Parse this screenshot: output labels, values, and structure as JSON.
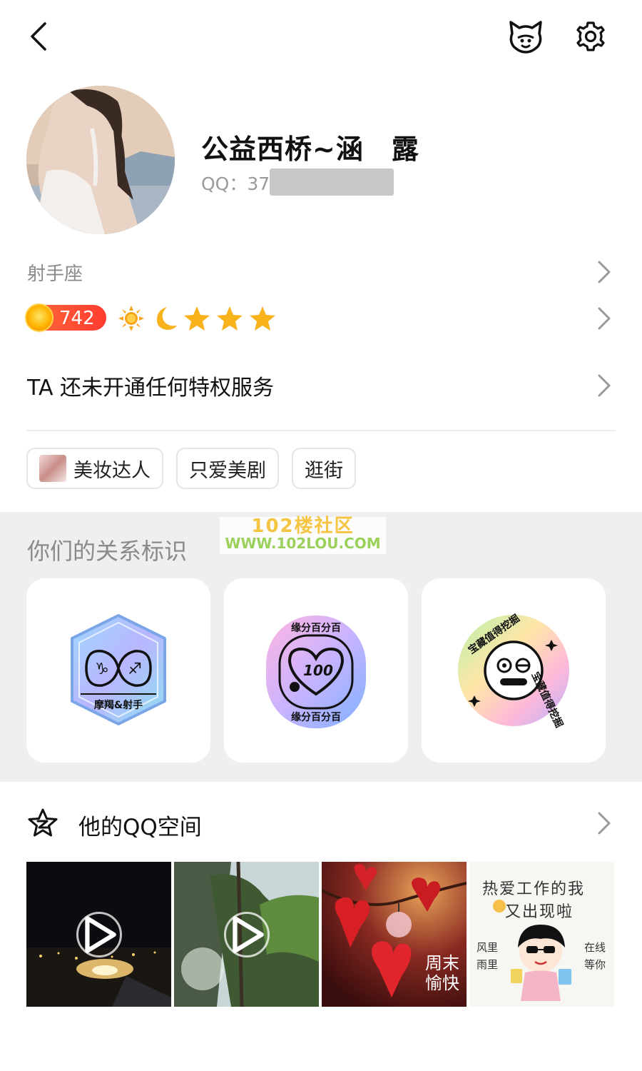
{
  "header": {
    "back_icon": "chevron-left-icon",
    "pet_icon": "pet-face-icon",
    "settings_icon": "gear-icon"
  },
  "profile": {
    "nickname": "公益西桥~涵　露",
    "qq_prefix": "QQ：37"
  },
  "zodiac": {
    "label": "射手座"
  },
  "level": {
    "number": "742",
    "icons": [
      "sun-icon",
      "moon-icon",
      "star-icon",
      "star-icon",
      "star-icon"
    ]
  },
  "privilege": {
    "label": "TA 还未开通任何特权服务"
  },
  "tags": [
    {
      "label": "美妆达人",
      "has_thumb": true
    },
    {
      "label": "只爱美剧",
      "has_thumb": false
    },
    {
      "label": "逛街",
      "has_thumb": false
    }
  ],
  "relation": {
    "title": "你们的关系标识",
    "badges": [
      {
        "name": "zodiac-badge",
        "caption": "摩羯&射手",
        "symbols": [
          "♑",
          "♐"
        ]
      },
      {
        "name": "fate-badge",
        "ring_text": "缘分百分百",
        "inner": "100"
      },
      {
        "name": "treasure-badge",
        "ring_text": "宝藏值得挖掘"
      }
    ]
  },
  "watermark": {
    "line1": "102楼社区",
    "line2": "WWW.102LOU.COM"
  },
  "qzone": {
    "title": "他的QQ空间",
    "photos": [
      {
        "kind": "video"
      },
      {
        "kind": "video"
      },
      {
        "kind": "image",
        "text_big": "周末愉快"
      },
      {
        "kind": "image",
        "line1": "热爱工作的我",
        "line2": "又出现啦",
        "left_text": "风里 雨里",
        "right_text": "在线 等你"
      }
    ]
  },
  "colors": {
    "accent_orange": "#ff4d2e",
    "text_gray": "#8a8a8a",
    "section_bg": "#efeff2"
  }
}
